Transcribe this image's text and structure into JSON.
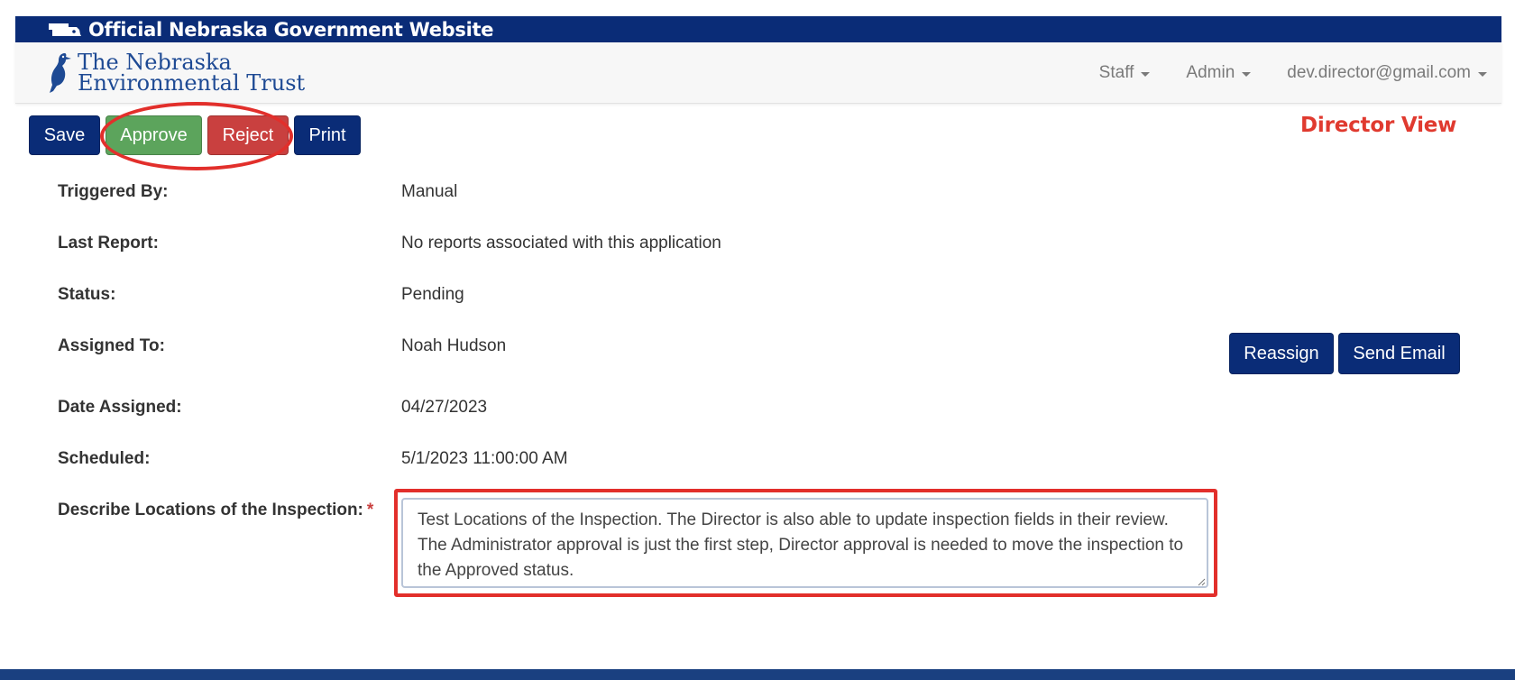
{
  "gov_banner": {
    "text": "Official Nebraska Government Website",
    "icon": "nebraska-state-icon"
  },
  "brand": {
    "line1": "The Nebraska",
    "line2": "Environmental Trust",
    "logo": "meadowlark-bird-icon",
    "color": "#1e4a94"
  },
  "nav": {
    "staff": "Staff",
    "admin": "Admin",
    "user": "dev.director@gmail.com"
  },
  "toolbar": {
    "save": "Save",
    "approve": "Approve",
    "reject": "Reject",
    "print": "Print"
  },
  "view_label": "Director View",
  "details": {
    "triggered_by": {
      "label": "Triggered By:",
      "value": "Manual"
    },
    "last_report": {
      "label": "Last Report:",
      "value": "No reports associated with this application"
    },
    "status": {
      "label": "Status:",
      "value": "Pending"
    },
    "assigned_to": {
      "label": "Assigned To:",
      "value": "Noah Hudson"
    },
    "date_assigned": {
      "label": "Date Assigned:",
      "value": "04/27/2023"
    },
    "scheduled": {
      "label": "Scheduled:",
      "value": "5/1/2023 11:00:00 AM"
    },
    "locations": {
      "label": "Describe Locations of the Inspection:",
      "required_marker": "*",
      "value": "Test Locations of the Inspection. The Director is also able to update inspection fields in their review. The Administrator approval is just the first step, Director approval is needed to move the inspection to the Approved status."
    }
  },
  "assign_actions": {
    "reassign": "Reassign",
    "send_email": "Send Email"
  },
  "colors": {
    "navy": "#0a2c77",
    "green": "#5ca45c",
    "red": "#c9403f",
    "annotation": "#e22f2b"
  }
}
